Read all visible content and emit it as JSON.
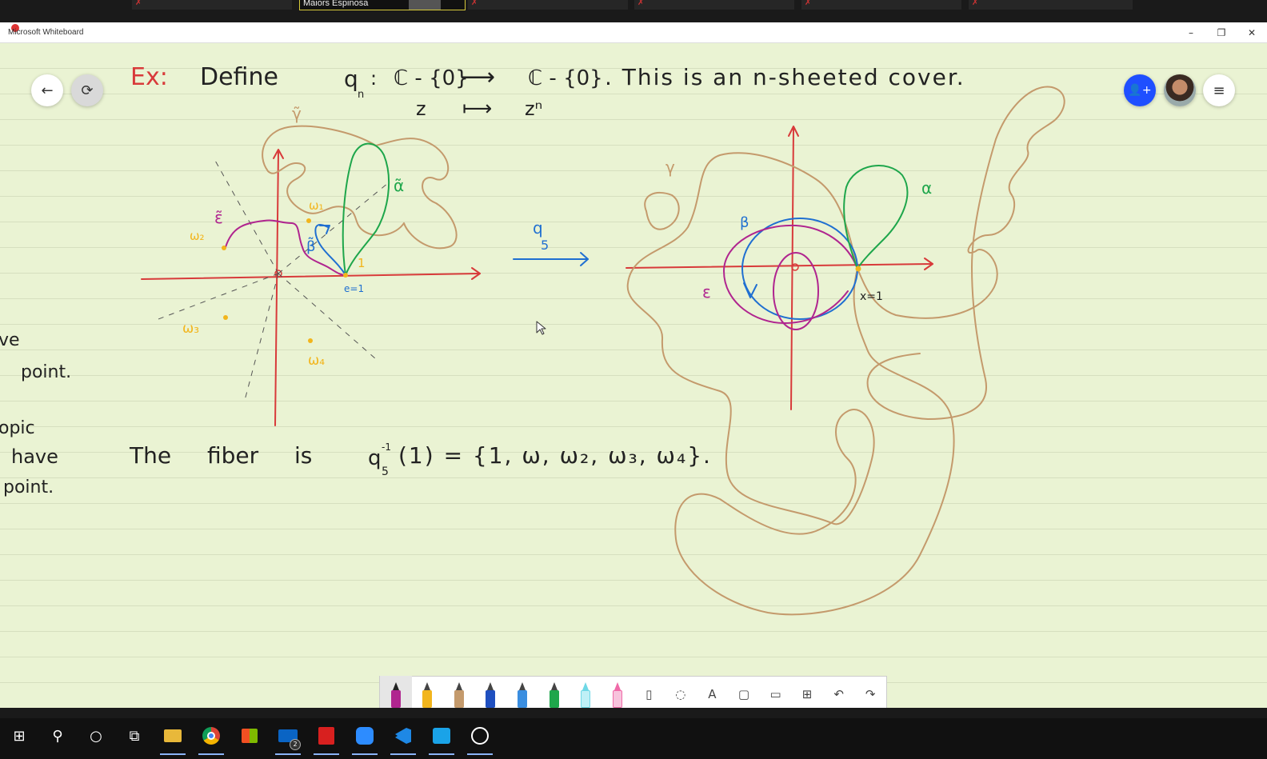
{
  "zoom": {
    "active_speaker": "Maiors Espinosa"
  },
  "window": {
    "title": "Microsoft Whiteboard",
    "minimize": "–",
    "restore": "❐",
    "close": "✕"
  },
  "board": {
    "line1": {
      "ex": "Ex:",
      "define": "Define",
      "q": "q",
      "qsub": "n",
      "colon": ":",
      "domain": "ℂ - {0}",
      "arrow": "⟶",
      "codomain": "ℂ - {0}",
      "this": ". This is an n-sheeted cover."
    },
    "line2": {
      "z": "z",
      "mapsto": "⟼",
      "zn": "zⁿ"
    },
    "left_plot_labels": {
      "gamma_t": "γ̃",
      "alpha_t": "α̃",
      "eps_t": "ε̃",
      "beta_t": "β̃",
      "w1": "ω₁",
      "w2": "ω₂",
      "w3": "ω₃",
      "w4": "ω₄",
      "one": "1",
      "e1": "e=1"
    },
    "map_label": {
      "q": "q",
      "sub": "5"
    },
    "right_plot_labels": {
      "gamma": "γ",
      "alpha": "α",
      "beta": "β",
      "eps": "ε",
      "x1": "x=1"
    },
    "left_margin": [
      "ve",
      "point.",
      "opic",
      "have",
      "point."
    ],
    "fiber": {
      "text": "The fiber is",
      "q": "q",
      "sub": "5",
      "sup": "-1",
      "set": "(1) = {1, ω, ω₂, ω₃, ω₄}."
    }
  },
  "toolbar": {
    "tools": [
      "pen-magenta",
      "pen-yellow",
      "pen-brown",
      "pen-blue",
      "pen-blue-light",
      "pen-green",
      "highlighter-cyan",
      "highlighter-pink",
      "ruler",
      "lasso",
      "text",
      "shape",
      "image",
      "add",
      "undo",
      "redo"
    ],
    "text_glyph": "A",
    "shape_glyph": "▢",
    "image_glyph": "▭",
    "add_glyph": "⊞",
    "undo_glyph": "↶",
    "redo_glyph": "↷",
    "lasso_glyph": "◌",
    "ruler_glyph": "▯"
  },
  "header_buttons": {
    "back": "←",
    "sync": "⟳",
    "invite": "👤+",
    "menu": "≡"
  },
  "taskbar": {
    "start": "⊞",
    "search": "⚲",
    "cortana": "○",
    "taskview": "⧉",
    "mail_badge": "2"
  },
  "colors": {
    "red": "#d83a3a",
    "green": "#1ea64b",
    "blue": "#1f6fd1",
    "magenta": "#b0258f",
    "tan": "#c49a6c",
    "yellow": "#f2b51c",
    "black": "#222222"
  }
}
